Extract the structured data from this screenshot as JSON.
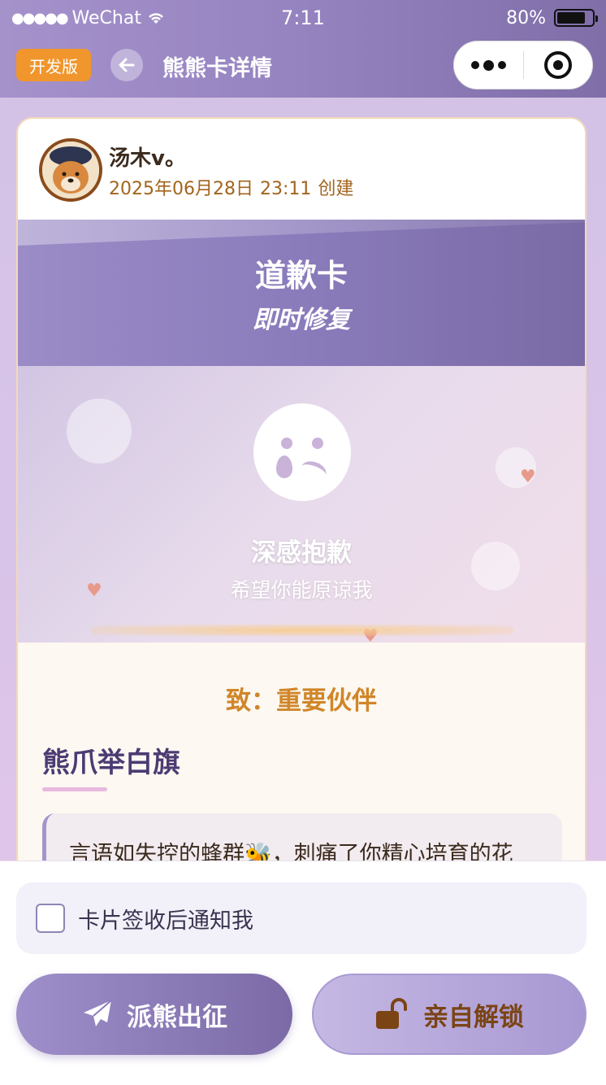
{
  "status_bar": {
    "carrier": "WeChat",
    "time": "7:11",
    "battery": "80%",
    "battery_level": 0.8
  },
  "nav": {
    "dev_badge": "开发版",
    "title": "熊熊卡详情"
  },
  "card": {
    "user": {
      "name": "汤木v。",
      "created_date": "2025年06月28日",
      "created_time": "23:11",
      "created_suffix": "创建"
    },
    "banner": {
      "title": "道歉卡",
      "subtitle": "即时修复"
    },
    "illustration": {
      "icon": "crying-face-icon",
      "title": "深感抱歉",
      "subtitle": "希望你能原谅我"
    },
    "to_line": "致：重要伙伴",
    "section_title": "熊爪举白旗",
    "message": "言语如失控的蜂群🐝，刺痛了你精心培育的花"
  },
  "bottom": {
    "notify_label": "卡片签收后通知我",
    "notify_checked": false,
    "send_button": "派熊出征",
    "unlock_button": "亲自解锁"
  },
  "colors": {
    "accent_purple": "#8a7bbb",
    "dev_badge": "#f0962d",
    "to_line": "#d08629",
    "section_title": "#4c3b73"
  }
}
